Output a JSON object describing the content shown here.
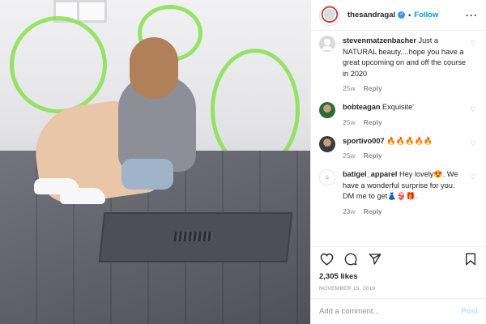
{
  "header": {
    "username": "thesandragal",
    "verified_icon": "verified-badge-icon",
    "separator": "•",
    "follow_label": "Follow",
    "more_icon": "more-options-icon"
  },
  "photo": {
    "alt_icon": "post-photo"
  },
  "comments": [
    {
      "username": "stevenmatzenbacher",
      "text": "Just a NATURAL beauty....hope you have a great upcoming on and off the course in 2020",
      "time": "25w",
      "reply": "Reply",
      "avatar_icon": "default-avatar-icon"
    },
    {
      "username": "bobteagan",
      "text": "Exquisite'",
      "time": "25w",
      "reply": "Reply",
      "avatar_icon": "user-avatar"
    },
    {
      "username": "sportivo007",
      "text": "🔥🔥🔥🔥🔥",
      "time": "25w",
      "reply": "Reply",
      "avatar_icon": "user-avatar"
    },
    {
      "username": "batigel_apparel",
      "text": "Hey lovely😍. We have a wonderful surprise for you. DM me to get👗👙🎁.",
      "time": "23w",
      "reply": "Reply",
      "avatar_icon": "brand-logo-avatar"
    }
  ],
  "actions": {
    "like_icon": "heart-icon",
    "comment_icon": "comment-icon",
    "share_icon": "share-icon",
    "save_icon": "bookmark-icon"
  },
  "likes": "2,305 likes",
  "date": "NOVEMBER 15, 2019",
  "add_comment": {
    "placeholder": "Add a comment...",
    "post_label": "Post"
  },
  "colors": {
    "link_blue": "#0095f6",
    "verified_blue": "#3897f0",
    "muted_text": "#8e8e8e",
    "post_disabled": "#b2dffc",
    "graffiti_green": "#86e04c"
  }
}
